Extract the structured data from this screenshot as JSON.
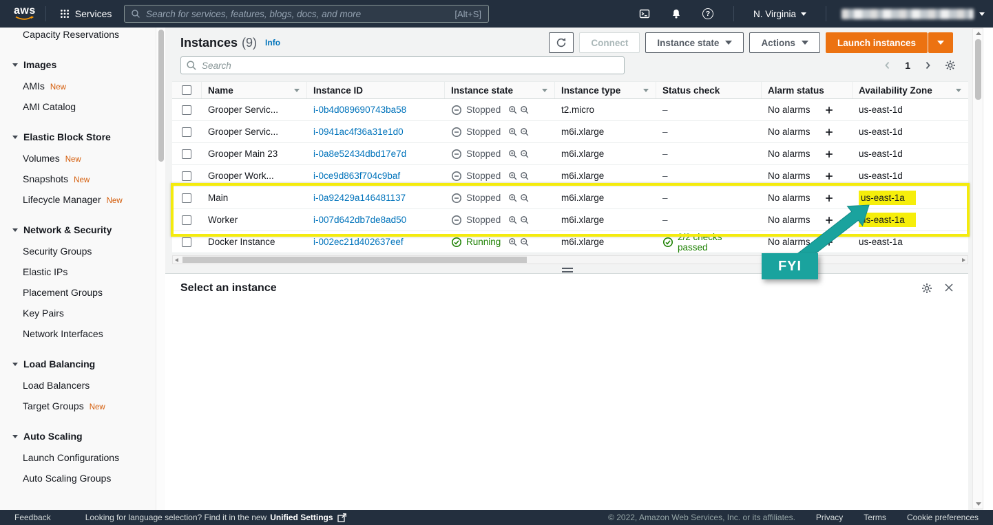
{
  "topbar": {
    "logo_text": "aws",
    "services_label": "Services",
    "search_placeholder": "Search for services, features, blogs, docs, and more",
    "search_shortcut": "[Alt+S]",
    "region_label": "N. Virginia",
    "help_glyph": "?"
  },
  "sidebar": {
    "partial_top_item": "Capacity Reservations",
    "groups": [
      {
        "header": "Images",
        "items": [
          {
            "label": "AMIs",
            "badge": "New"
          },
          {
            "label": "AMI Catalog",
            "badge": ""
          }
        ]
      },
      {
        "header": "Elastic Block Store",
        "items": [
          {
            "label": "Volumes",
            "badge": "New"
          },
          {
            "label": "Snapshots",
            "badge": "New"
          },
          {
            "label": "Lifecycle Manager",
            "badge": "New"
          }
        ]
      },
      {
        "header": "Network & Security",
        "items": [
          {
            "label": "Security Groups",
            "badge": ""
          },
          {
            "label": "Elastic IPs",
            "badge": ""
          },
          {
            "label": "Placement Groups",
            "badge": ""
          },
          {
            "label": "Key Pairs",
            "badge": ""
          },
          {
            "label": "Network Interfaces",
            "badge": ""
          }
        ]
      },
      {
        "header": "Load Balancing",
        "items": [
          {
            "label": "Load Balancers",
            "badge": ""
          },
          {
            "label": "Target Groups",
            "badge": "New"
          }
        ]
      },
      {
        "header": "Auto Scaling",
        "items": [
          {
            "label": "Launch Configurations",
            "badge": ""
          },
          {
            "label": "Auto Scaling Groups",
            "badge": ""
          }
        ]
      }
    ]
  },
  "toolbar": {
    "title": "Instances",
    "count": "(9)",
    "info_label": "Info",
    "connect_label": "Connect",
    "instance_state_label": "Instance state",
    "actions_label": "Actions",
    "launch_label": "Launch instances"
  },
  "filterbar": {
    "search_placeholder": "Search",
    "page_number": "1"
  },
  "table": {
    "headers": {
      "name": "Name",
      "instance_id": "Instance ID",
      "instance_state": "Instance state",
      "instance_type": "Instance type",
      "status_check": "Status check",
      "alarm_status": "Alarm status",
      "availability_zone": "Availability Zone"
    },
    "rows": [
      {
        "name": "Grooper Servic...",
        "instance_id": "i-0b4d089690743ba58",
        "state": "Stopped",
        "type": "t2.micro",
        "status_check": "–",
        "alarm": "No alarms",
        "az": "us-east-1d"
      },
      {
        "name": "Grooper Servic...",
        "instance_id": "i-0941ac4f36a31e1d0",
        "state": "Stopped",
        "type": "m6i.xlarge",
        "status_check": "–",
        "alarm": "No alarms",
        "az": "us-east-1d"
      },
      {
        "name": "Grooper Main 23",
        "instance_id": "i-0a8e52434dbd17e7d",
        "state": "Stopped",
        "type": "m6i.xlarge",
        "status_check": "–",
        "alarm": "No alarms",
        "az": "us-east-1d"
      },
      {
        "name": "Grooper Work...",
        "instance_id": "i-0ce9d863f704c9baf",
        "state": "Stopped",
        "type": "m6i.xlarge",
        "status_check": "–",
        "alarm": "No alarms",
        "az": "us-east-1d"
      },
      {
        "name": "Main",
        "instance_id": "i-0a92429a146481137",
        "state": "Stopped",
        "type": "m6i.xlarge",
        "status_check": "–",
        "alarm": "No alarms",
        "az": "us-east-1a"
      },
      {
        "name": "Worker",
        "instance_id": "i-007d642db7de8ad50",
        "state": "Stopped",
        "type": "m6i.xlarge",
        "status_check": "–",
        "alarm": "No alarms",
        "az": "us-east-1a"
      },
      {
        "name": "Docker Instance",
        "instance_id": "i-002ec21d402637eef",
        "state": "Running",
        "type": "m6i.xlarge",
        "status_check": "2/2 checks passed",
        "alarm": "No alarms",
        "az": "us-east-1a"
      }
    ]
  },
  "annotation": {
    "fyi_label": "FYI",
    "highlight_color": "#f6ee0b",
    "arrow_color": "#1aa39e"
  },
  "panel": {
    "title": "Select an instance"
  },
  "footer": {
    "feedback_label": "Feedback",
    "language_text": "Looking for language selection? Find it in the new",
    "language_link": "Unified Settings",
    "copyright": "© 2022, Amazon Web Services, Inc. or its affiliates.",
    "privacy_label": "Privacy",
    "terms_label": "Terms",
    "cookie_label": "Cookie preferences"
  }
}
